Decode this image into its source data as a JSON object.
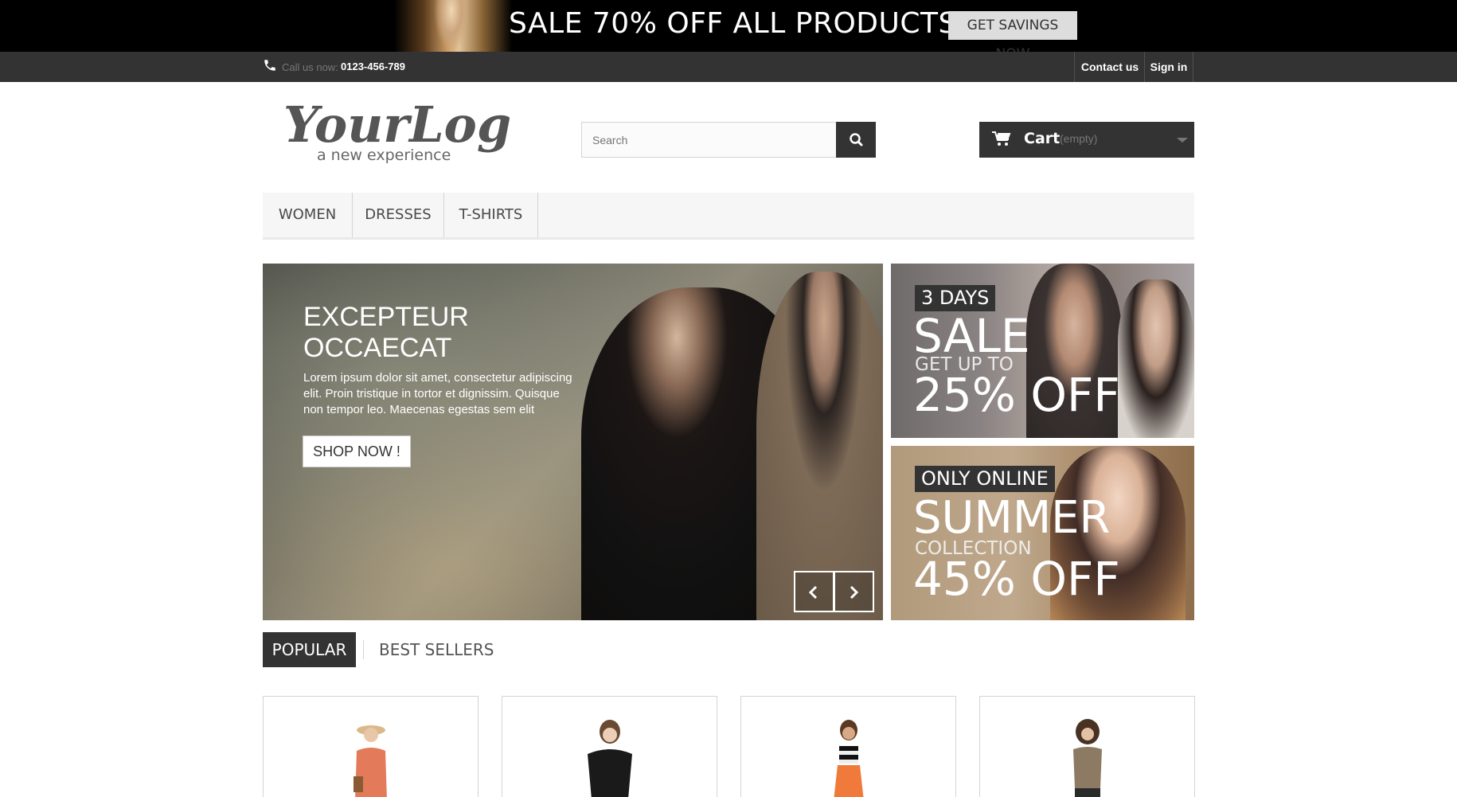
{
  "promo": {
    "text": "SALE 70% OFF ALL PRODUCTS",
    "button": "GET SAVINGS NOW"
  },
  "topbar": {
    "call_label": "Call us now:",
    "phone": "0123-456-789",
    "contact": "Contact us",
    "signin": "Sign in"
  },
  "header": {
    "logo_main": "YourLogo",
    "logo_tagline": "a new experience",
    "search_placeholder": "Search",
    "cart_label": "Cart",
    "cart_status": "(empty)"
  },
  "menu": {
    "items": [
      {
        "label": "WOMEN"
      },
      {
        "label": "DRESSES"
      },
      {
        "label": "T-SHIRTS"
      }
    ]
  },
  "slider": {
    "title_line1": "EXCEPTEUR",
    "title_line2": "OCCAECAT",
    "text": "Lorem ipsum dolor sit amet, consectetur adipiscing elit. Proin tristique in tortor et dignissim. Quisque non tempor leo. Maecenas egestas sem elit",
    "button": "SHOP NOW !"
  },
  "banners": [
    {
      "tag": "3 DAYS",
      "big1": "SALE",
      "small": "GET UP TO",
      "big2": "25% OFF"
    },
    {
      "tag": "ONLY ONLINE",
      "big1": "SUMMER",
      "small": "COLLECTION",
      "big2": "45% OFF"
    }
  ],
  "tabs": {
    "popular": "POPULAR",
    "best_sellers": "BEST SELLERS"
  },
  "products": [
    {
      "icon": "product-image-1"
    },
    {
      "icon": "product-image-2"
    },
    {
      "icon": "product-image-3"
    },
    {
      "icon": "product-image-4"
    }
  ],
  "colors": {
    "dark": "#333333",
    "promo_bg": "#000000",
    "menu_bg": "#f6f6f6"
  }
}
